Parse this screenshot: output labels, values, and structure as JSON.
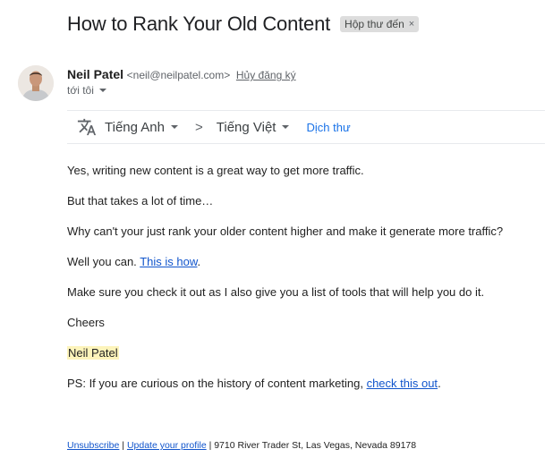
{
  "email": {
    "subject": "How to Rank Your Old Content",
    "label": "Hộp thư đến",
    "label_remove": "×"
  },
  "sender": {
    "name": "Neil Patel",
    "email": "<neil@neilpatel.com>",
    "unsubscribe": "Hủy đăng ký",
    "to": "tới tôi"
  },
  "translate": {
    "icon": "translate-icon",
    "from": "Tiếng Anh",
    "arrow": ">",
    "to": "Tiếng Việt",
    "action": "Dịch thư"
  },
  "body": {
    "p1": "Yes, writing new content is a great way to get more traffic.",
    "p2": "But that takes a lot of time…",
    "p3": "Why can't your just rank your older content higher and make it generate more traffic?",
    "p4_text": "Well you can. ",
    "p4_link": "This is how",
    "p4_end": ".",
    "p5": "Make sure you check it out as I also give you a list of tools that will help you do it.",
    "p6": "Cheers",
    "signature": "Neil Patel",
    "ps_text": "PS: If you are curious on the history of content marketing, ",
    "ps_link": "check this out",
    "ps_end": "."
  },
  "footer": {
    "unsubscribe": "Unsubscribe",
    "sep1": " | ",
    "update_profile": "Update your profile",
    "address": " | 9710 River Trader St, Las Vegas, Nevada 89178"
  }
}
